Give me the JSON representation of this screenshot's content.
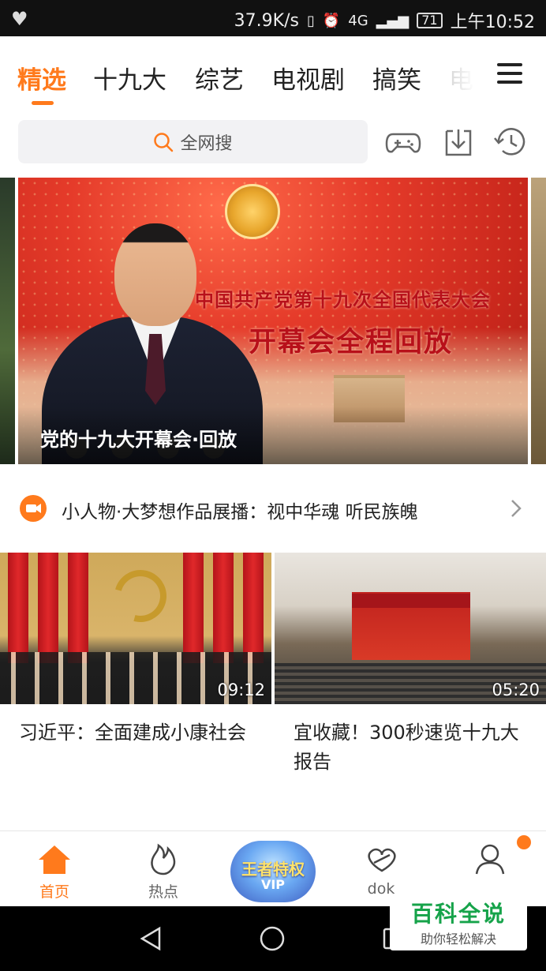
{
  "status_bar": {
    "speed": "37.9K/s",
    "network": "4G",
    "battery": "71",
    "time": "上午10:52"
  },
  "tabs": [
    {
      "label": "精选",
      "active": true
    },
    {
      "label": "十九大"
    },
    {
      "label": "综艺"
    },
    {
      "label": "电视剧"
    },
    {
      "label": "搞笑"
    },
    {
      "label": "电"
    }
  ],
  "search": {
    "placeholder": "全网搜"
  },
  "toolbar_icons": [
    "gamepad-icon",
    "download-icon",
    "history-icon"
  ],
  "banner": {
    "headline_line1": "中国共产党第十九次全国代表大会",
    "headline_line2": "开幕会全程回放",
    "caption": "党的十九大开幕会·回放"
  },
  "notice": {
    "text": "小人物·大梦想作品展播：视中华魂 听民族魄"
  },
  "videos": [
    {
      "title": "习近平：全面建成小康社会",
      "duration": "09:12"
    },
    {
      "title": "宜收藏！300秒速览十九大报告",
      "duration": "05:20"
    }
  ],
  "bottom_nav": [
    {
      "label": "首页",
      "active": true
    },
    {
      "label": "热点"
    },
    {
      "label": "王者特权",
      "sub": "VIP"
    },
    {
      "label": "dok"
    },
    {
      "label": ""
    }
  ],
  "watermark": {
    "title": "百科全说",
    "subtitle": "助你轻松解决"
  },
  "colors": {
    "accent": "#ff7a1c",
    "status_bar": "#111111",
    "search_bg": "#f2f2f4"
  }
}
